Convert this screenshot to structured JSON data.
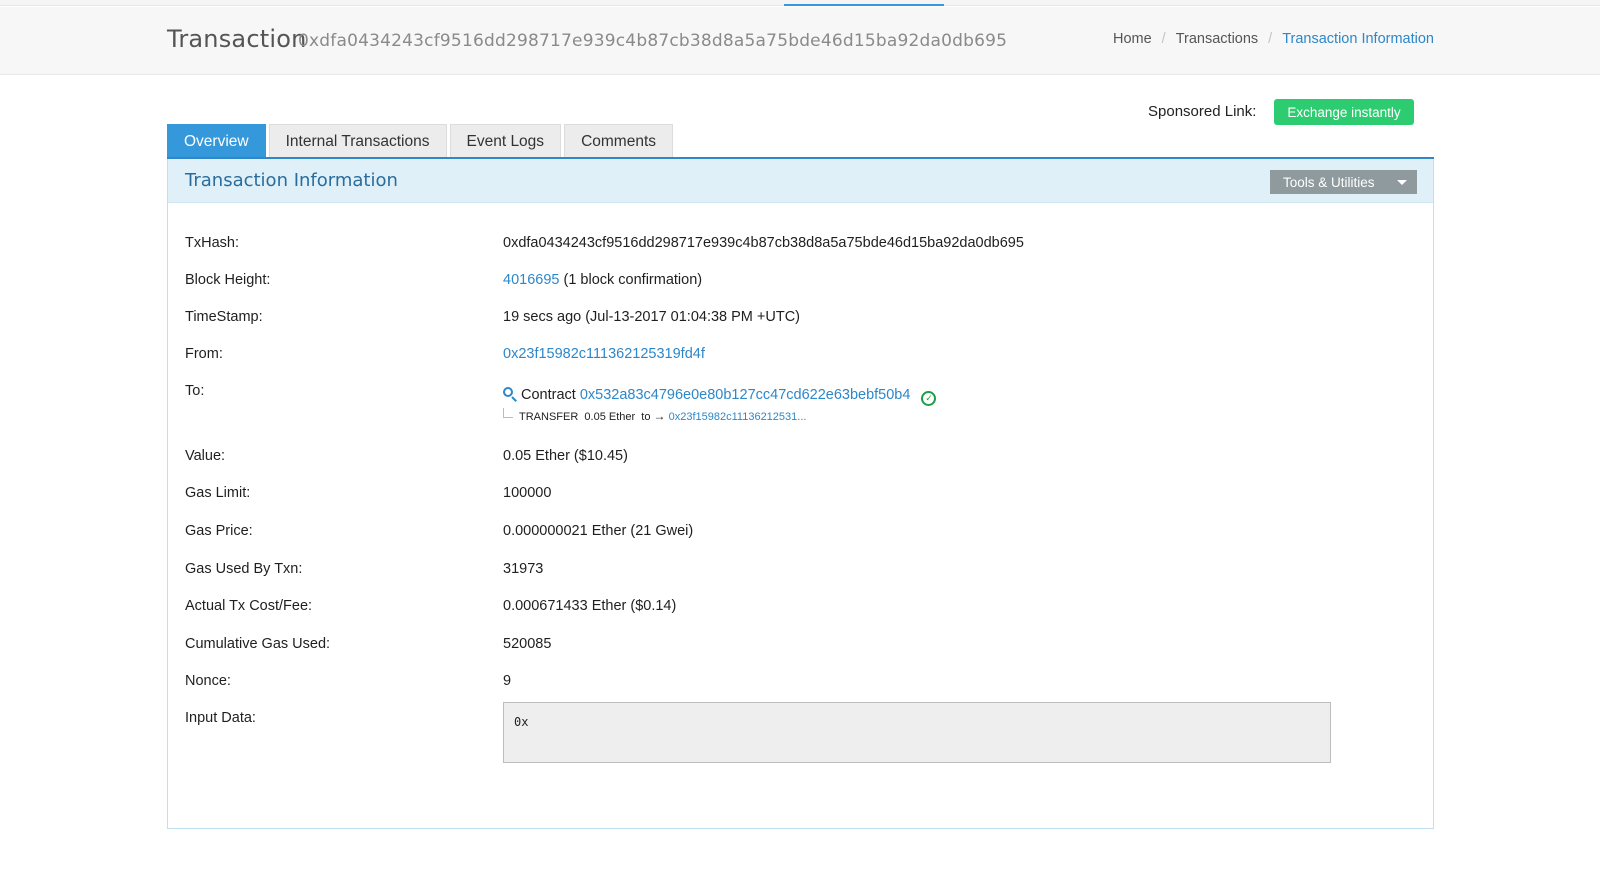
{
  "header": {
    "title": "Transaction",
    "hash": "0xdfa0434243cf9516dd298717e939c4b87cb38d8a5a75bde46d15ba92da0db695",
    "breadcrumb": {
      "home": "Home",
      "transactions": "Transactions",
      "current": "Transaction Information",
      "separator": "/"
    }
  },
  "sponsored": {
    "label": "Sponsored Link:",
    "button": "Exchange instantly",
    "button_color": "#2ecc71"
  },
  "tabs": [
    {
      "label": "Overview",
      "active": true
    },
    {
      "label": "Internal Transactions",
      "active": false
    },
    {
      "label": "Event Logs",
      "active": false
    },
    {
      "label": "Comments",
      "active": false
    }
  ],
  "panel": {
    "title": "Transaction Information",
    "tools_button": "Tools & Utilities"
  },
  "details": {
    "txhash": {
      "label": "TxHash:",
      "value": "0xdfa0434243cf9516dd298717e939c4b87cb38d8a5a75bde46d15ba92da0db695"
    },
    "block_height": {
      "label": "Block Height:",
      "block": "4016695",
      "confirmations": "(1 block confirmation)"
    },
    "timestamp": {
      "label": "TimeStamp:",
      "value": "19 secs ago (Jul-13-2017 01:04:38 PM +UTC)"
    },
    "from": {
      "label": "From:",
      "value": "0x23f15982c111362125319fd4f"
    },
    "to": {
      "label": "To:",
      "contract_prefix": "Contract",
      "contract_address": "0x532a83c4796e0e80b127cc47cd622e63bebf50b4",
      "transfer_type": "TRANSFER",
      "transfer_amount": "0.05 Ether",
      "transfer_to_label": "to",
      "transfer_arrow": "→",
      "transfer_to_address": "0x23f15982c11136212531...",
      "check_glyph": "✓"
    },
    "value": {
      "label": "Value:",
      "value": "0.05 Ether ($10.45)"
    },
    "gas_limit": {
      "label": "Gas Limit:",
      "value": "100000"
    },
    "gas_price": {
      "label": "Gas Price:",
      "value": "0.000000021 Ether (21 Gwei)"
    },
    "gas_used": {
      "label": "Gas Used By Txn:",
      "value": "31973"
    },
    "tx_fee": {
      "label": "Actual Tx Cost/Fee:",
      "value": "0.000671433 Ether ($0.14)"
    },
    "cumulative_gas": {
      "label": "Cumulative Gas Used:",
      "value": "520085"
    },
    "nonce": {
      "label": "Nonce:",
      "value": "9"
    },
    "input_data": {
      "label": "Input Data:",
      "value": "0x"
    }
  },
  "colors": {
    "accent": "#3498db",
    "link": "#2d87c9",
    "success": "#1e9e48",
    "panel_head": "#dff0f8"
  },
  "icons": {
    "magnify": "magnifying-glass-icon",
    "check": "check-circle-icon",
    "caret": "caret-down-icon"
  }
}
